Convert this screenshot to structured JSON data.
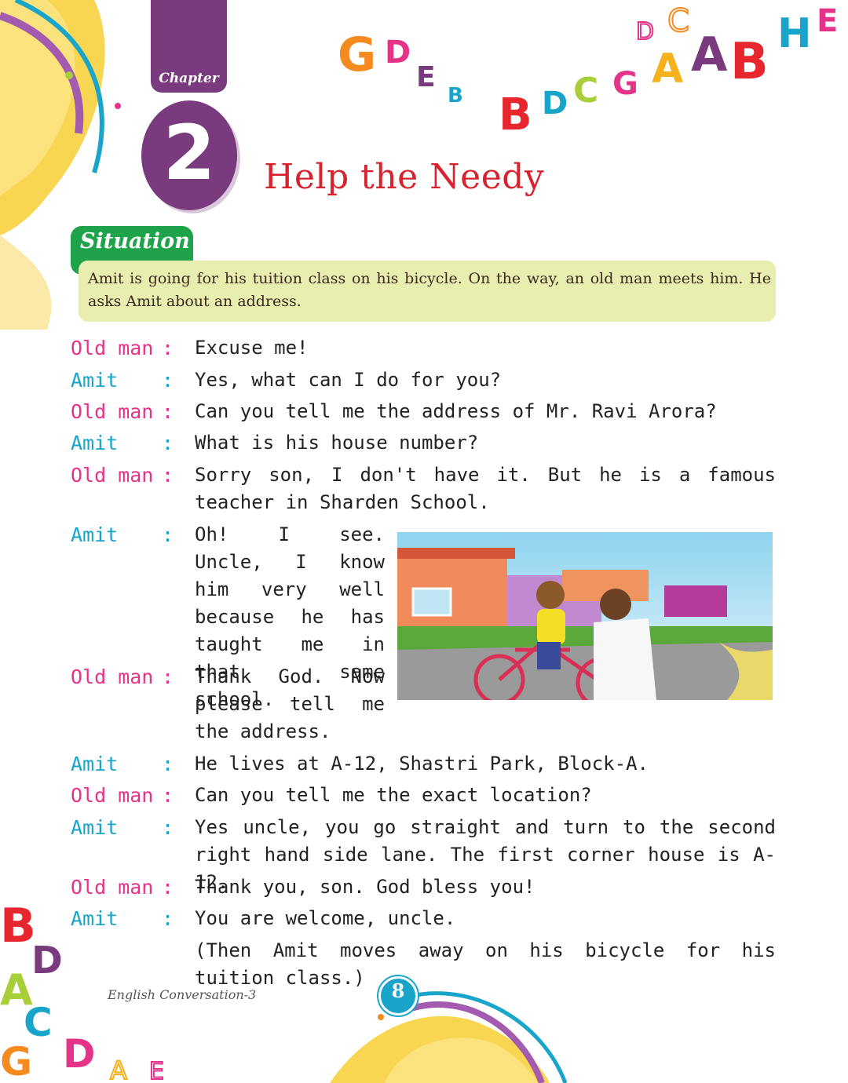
{
  "chapter": {
    "label": "Chapter",
    "number": "2",
    "title": "Help the Needy"
  },
  "situation": {
    "label": "Situation",
    "text": "Amit is going for his tuition class on his bicycle. On the way, an old man meets him. He asks Amit about an address."
  },
  "colors": {
    "old_man": "#e6338a",
    "amit": "#19a4c9",
    "title": "#d8232f",
    "chapter": "#7a3b7e",
    "situation": "#1fa34a"
  },
  "dialogue": [
    {
      "speaker": "Old man",
      "colon": ":",
      "text": "Excuse me!"
    },
    {
      "speaker": "Amit",
      "colon": ":",
      "text": "Yes, what can I do for you?"
    },
    {
      "speaker": "Old man",
      "colon": ":",
      "text": "Can you tell me the address of Mr. Ravi Arora?"
    },
    {
      "speaker": "Amit",
      "colon": ":",
      "text": "What is his house number?"
    },
    {
      "speaker": "Old man",
      "colon": ":",
      "text": "Sorry son, I don't have it. But he is a famous teacher in Sharden School."
    },
    {
      "speaker": "Amit",
      "colon": ":",
      "text": "Oh! I see. Uncle, I know him very well because he has taught me in that same school."
    },
    {
      "speaker": "Old man",
      "colon": ":",
      "text": "Thank God. Now please tell me the address."
    },
    {
      "speaker": "Amit",
      "colon": ":",
      "text": "He lives at A-12, Shastri Park, Block-A."
    },
    {
      "speaker": "Old man",
      "colon": ":",
      "text": "Can you tell me the exact location?"
    },
    {
      "speaker": "Amit",
      "colon": ":",
      "text": "Yes uncle, you go straight and turn to the second right hand side lane. The first corner house is A-12."
    },
    {
      "speaker": "Old man",
      "colon": ":",
      "text": "Thank you, son. God bless you!"
    },
    {
      "speaker": "Amit",
      "colon": ":",
      "text": "You are welcome, uncle."
    }
  ],
  "closing_note": "(Then Amit moves away on his bicycle for his tuition class.)",
  "footer": {
    "book": "English Conversation-3",
    "page": "8"
  }
}
